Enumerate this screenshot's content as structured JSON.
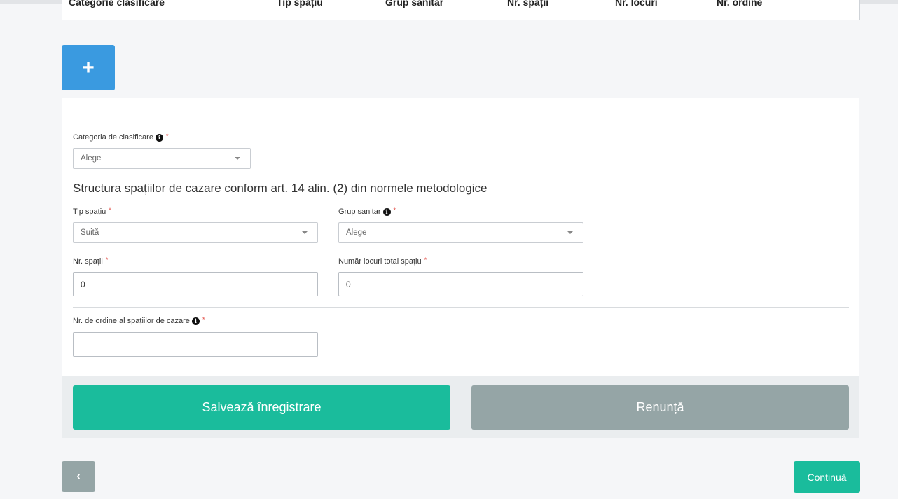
{
  "table": {
    "columns": [
      "Categorie clasificare",
      "Tip spațiu",
      "Grup sanitar",
      "Nr. spații",
      "Nr. locuri",
      "Nr. ordine"
    ]
  },
  "add_button": {
    "label": "+"
  },
  "form": {
    "categorie": {
      "label": "Categoria de clasificare",
      "required": "*",
      "value": "Alege"
    },
    "section_title": "Structura spațiilor de cazare conform art. 14 alin. (2) din normele metodologice",
    "tip_spatiu": {
      "label": "Tip spațiu",
      "required": "*",
      "value": "Suită"
    },
    "grup_sanitar": {
      "label": "Grup sanitar",
      "required": "*",
      "value": "Alege"
    },
    "nr_spatii": {
      "label": "Nr. spații",
      "required": "*",
      "value": "0"
    },
    "numar_locuri": {
      "label": "Număr locuri total spațiu",
      "required": "*",
      "value": "0"
    },
    "nr_ordine": {
      "label": "Nr. de ordine al spațiilor de cazare",
      "required": "*",
      "value": ""
    }
  },
  "actions": {
    "save_label": "Salvează înregistrare",
    "cancel_label": "Renunță",
    "back_label": "‹",
    "continue_label": "Continuă"
  },
  "icons": {
    "info": "info-icon",
    "back": "chevron-left-icon",
    "add": "plus-icon",
    "caret": "caret-down-icon"
  },
  "colors": {
    "primary_blue": "#3a9ae0",
    "teal": "#1abc9c",
    "gray": "#95a5a6",
    "required_red": "#e0443c"
  }
}
